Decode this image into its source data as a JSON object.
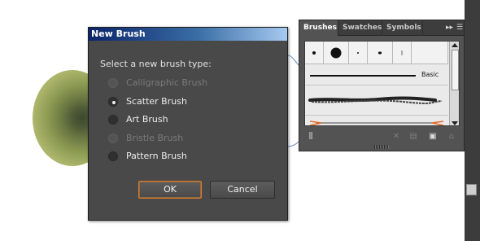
{
  "dialog": {
    "title": "New Brush",
    "prompt": "Select a new brush type:",
    "options": [
      {
        "label": "Calligraphic Brush",
        "enabled": false,
        "selected": false
      },
      {
        "label": "Scatter Brush",
        "enabled": true,
        "selected": true
      },
      {
        "label": "Art Brush",
        "enabled": true,
        "selected": false
      },
      {
        "label": "Bristle Brush",
        "enabled": false,
        "selected": false
      },
      {
        "label": "Pattern Brush",
        "enabled": true,
        "selected": false
      }
    ],
    "ok_label": "OK",
    "cancel_label": "Cancel"
  },
  "panel": {
    "tabs": [
      "Brushes",
      "Swatches",
      "Symbols"
    ],
    "active_tab": "Brushes",
    "basic_label": "Basic",
    "icons": {
      "collapse": "double-chevron-right-icon",
      "menu": "panel-menu-icon",
      "libraries": "brush-libraries-icon",
      "remove_stroke": "remove-stroke-icon",
      "options": "options-icon",
      "new": "new-brush-icon",
      "delete": "trash-icon"
    }
  },
  "colors": {
    "dialog_bg": "#494949",
    "titlebar_start": "#0a246a",
    "titlebar_end": "#a6caf0",
    "ok_focus": "#e07a1f",
    "arrow_brush": "#e06a2a",
    "connector": "#6a86c8"
  }
}
